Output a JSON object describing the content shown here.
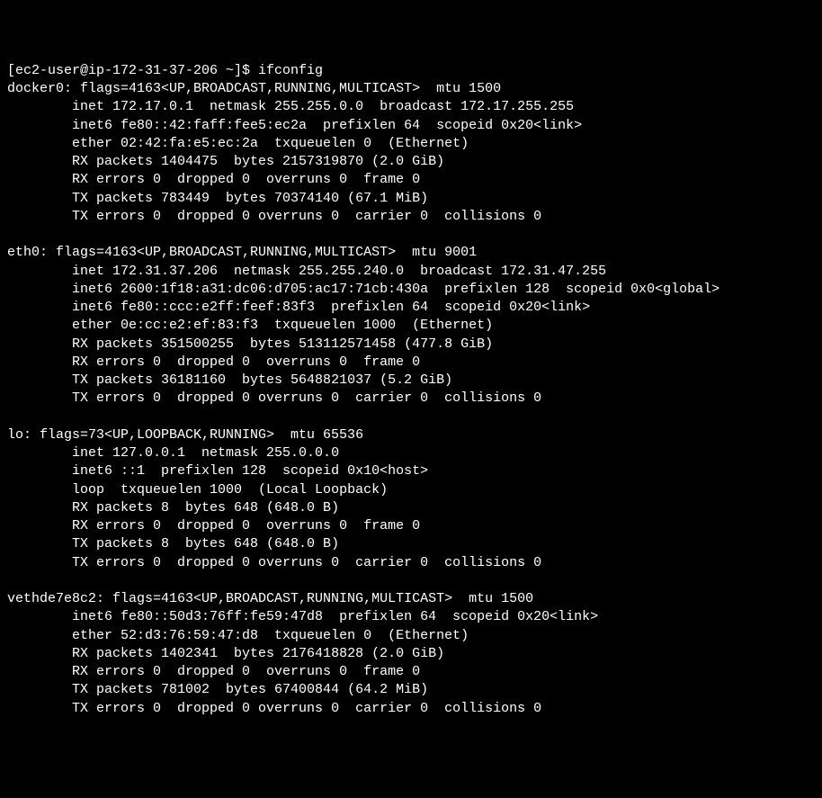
{
  "prompt": {
    "user_host": "[ec2-user@ip-172-31-37-206 ~]$ ",
    "command": "ifconfig"
  },
  "interfaces": [
    {
      "name": "docker0",
      "header": "docker0: flags=4163<UP,BROADCAST,RUNNING,MULTICAST>  mtu 1500",
      "lines": [
        "inet 172.17.0.1  netmask 255.255.0.0  broadcast 172.17.255.255",
        "inet6 fe80::42:faff:fee5:ec2a  prefixlen 64  scopeid 0x20<link>",
        "ether 02:42:fa:e5:ec:2a  txqueuelen 0  (Ethernet)",
        "RX packets 1404475  bytes 2157319870 (2.0 GiB)",
        "RX errors 0  dropped 0  overruns 0  frame 0",
        "TX packets 783449  bytes 70374140 (67.1 MiB)",
        "TX errors 0  dropped 0 overruns 0  carrier 0  collisions 0"
      ]
    },
    {
      "name": "eth0",
      "header": "eth0: flags=4163<UP,BROADCAST,RUNNING,MULTICAST>  mtu 9001",
      "lines": [
        "inet 172.31.37.206  netmask 255.255.240.0  broadcast 172.31.47.255",
        "inet6 2600:1f18:a31:dc06:d705:ac17:71cb:430a  prefixlen 128  scopeid 0x0<global>",
        "inet6 fe80::ccc:e2ff:feef:83f3  prefixlen 64  scopeid 0x20<link>",
        "ether 0e:cc:e2:ef:83:f3  txqueuelen 1000  (Ethernet)",
        "RX packets 351500255  bytes 513112571458 (477.8 GiB)",
        "RX errors 0  dropped 0  overruns 0  frame 0",
        "TX packets 36181160  bytes 5648821037 (5.2 GiB)",
        "TX errors 0  dropped 0 overruns 0  carrier 0  collisions 0"
      ]
    },
    {
      "name": "lo",
      "header": "lo: flags=73<UP,LOOPBACK,RUNNING>  mtu 65536",
      "lines": [
        "inet 127.0.0.1  netmask 255.0.0.0",
        "inet6 ::1  prefixlen 128  scopeid 0x10<host>",
        "loop  txqueuelen 1000  (Local Loopback)",
        "RX packets 8  bytes 648 (648.0 B)",
        "RX errors 0  dropped 0  overruns 0  frame 0",
        "TX packets 8  bytes 648 (648.0 B)",
        "TX errors 0  dropped 0 overruns 0  carrier 0  collisions 0"
      ]
    },
    {
      "name": "vethde7e8c2",
      "header": "vethde7e8c2: flags=4163<UP,BROADCAST,RUNNING,MULTICAST>  mtu 1500",
      "lines": [
        "inet6 fe80::50d3:76ff:fe59:47d8  prefixlen 64  scopeid 0x20<link>",
        "ether 52:d3:76:59:47:d8  txqueuelen 0  (Ethernet)",
        "RX packets 1402341  bytes 2176418828 (2.0 GiB)",
        "RX errors 0  dropped 0  overruns 0  frame 0",
        "TX packets 781002  bytes 67400844 (64.2 MiB)",
        "TX errors 0  dropped 0 overruns 0  carrier 0  collisions 0"
      ]
    }
  ],
  "indent": "        "
}
